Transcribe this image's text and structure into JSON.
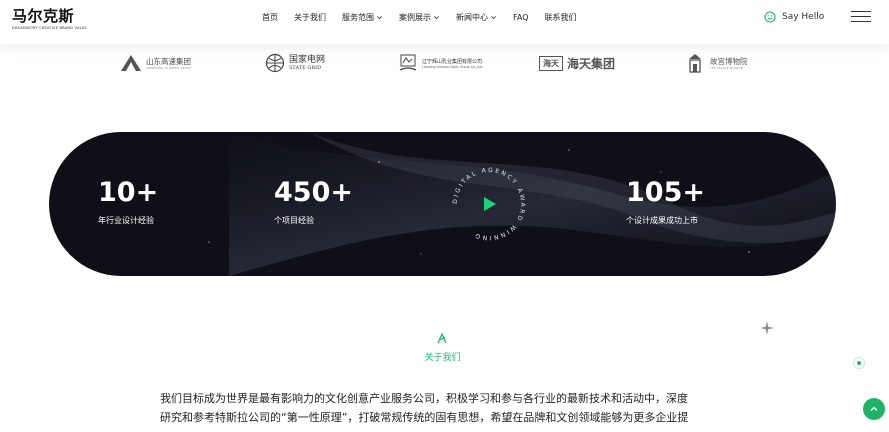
{
  "header": {
    "logo_text": "马尔克斯",
    "logo_sub": "DREAMWORY CREATIVE BRAND VALUE",
    "nav": [
      {
        "label": "首页",
        "dropdown": false
      },
      {
        "label": "关于我们",
        "dropdown": false
      },
      {
        "label": "服务范围",
        "dropdown": true
      },
      {
        "label": "案例展示",
        "dropdown": true
      },
      {
        "label": "新闻中心",
        "dropdown": true
      },
      {
        "label": "FAQ",
        "dropdown": false
      },
      {
        "label": "联系我们",
        "dropdown": false
      }
    ],
    "say_hello": "Say Hello"
  },
  "partners": {
    "sdgs": {
      "name": "山东高速集团",
      "sub": "SHANDONG HI-SPEED GROUP"
    },
    "stategrid": {
      "name": "国家电网",
      "sub": "STATE GRID"
    },
    "haidu": {
      "name": "辽宁辉山乳业集团有限公司",
      "sub": "Liaoning Huishan Dairy Group Co.,Ltd."
    },
    "haitian": {
      "badge": "海天",
      "name": "海天集团"
    },
    "museum": {
      "name": "故宫博物院",
      "sub": "THE PALACE MUSEUM"
    }
  },
  "stats": [
    {
      "value": "10+",
      "label": "年行业设计经验"
    },
    {
      "value": "450+",
      "label": "个项目经验"
    },
    {
      "value": "105+",
      "label": "个设计成果成功上市"
    }
  ],
  "award_ring_text": "DIGITAL AGENCY AWARD WINNING",
  "about": {
    "title": "关于我们",
    "lines": [
      "我们目标成为世界是最有影响力的文化创意产业服务公司，积极学习和参与各行业的最新技术和活动中，深度",
      "研究和参考特斯拉公司的“第一性原理”，打破常规传统的固有思想，希望在品牌和文创领域能够为更多企业提"
    ]
  },
  "colors": {
    "accent": "#1db96b",
    "banner": "#0e0f17"
  },
  "icons": {
    "say_hello": "chat-smile-icon",
    "menu": "hamburger-icon",
    "award_play": "play-icon",
    "back_to_top": "arrow-up-icon"
  }
}
